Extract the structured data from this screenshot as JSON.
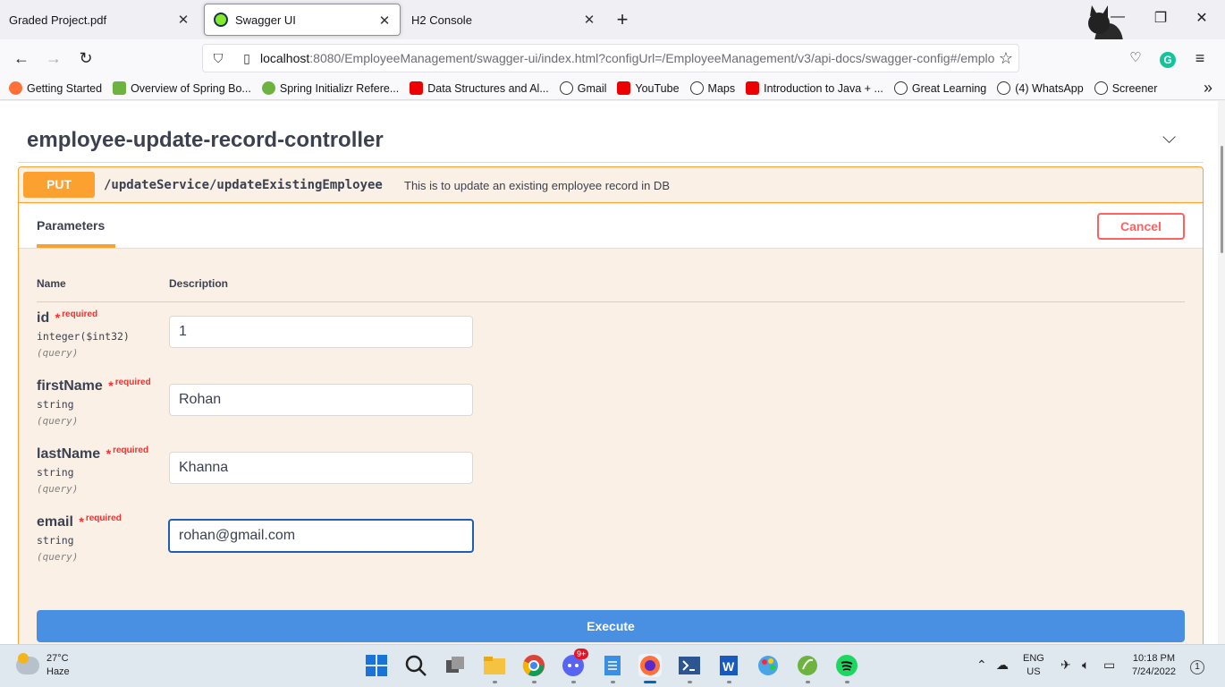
{
  "tabs": [
    {
      "title": "Graded Project.pdf",
      "close": "✕"
    },
    {
      "title": "Swagger UI",
      "close": "✕"
    },
    {
      "title": "H2 Console",
      "close": "✕"
    }
  ],
  "window_controls": {
    "minimize": "—",
    "restore": "❐",
    "close": "✕"
  },
  "url": {
    "host": "localhost",
    "rest": ":8080/EmployeeManagement/swagger-ui/index.html?configUrl=/EmployeeManagement/v3/api-docs/swagger-config#/emplo"
  },
  "bookmarks": [
    {
      "label": "Getting Started",
      "icon": "firefox-icon"
    },
    {
      "label": "Overview of Spring Bo...",
      "icon": "spring-icon"
    },
    {
      "label": "Spring Initializr Refere...",
      "icon": "spring-initializr-icon"
    },
    {
      "label": "Data Structures and Al...",
      "icon": "youtube-icon"
    },
    {
      "label": "Gmail",
      "icon": "globe-icon"
    },
    {
      "label": "YouTube",
      "icon": "youtube-icon"
    },
    {
      "label": "Maps",
      "icon": "globe-icon"
    },
    {
      "label": "Introduction to Java + ...",
      "icon": "youtube-icon"
    },
    {
      "label": "Great Learning",
      "icon": "globe-icon"
    },
    {
      "label": "(4) WhatsApp",
      "icon": "globe-icon"
    },
    {
      "label": "Screener",
      "icon": "globe-icon"
    }
  ],
  "section": {
    "title": "employee-update-record-controller"
  },
  "operation": {
    "method": "PUT",
    "path": "/updateService/updateExistingEmployee",
    "description": "This is to update an existing employee record in DB",
    "tab_label": "Parameters",
    "cancel_label": "Cancel",
    "col_name": "Name",
    "col_description": "Description",
    "required_label": "required",
    "required_star": "*",
    "params": [
      {
        "name": "id",
        "type": "integer($int32)",
        "in": "(query)",
        "value": "1"
      },
      {
        "name": "firstName",
        "type": "string",
        "in": "(query)",
        "value": "Rohan"
      },
      {
        "name": "lastName",
        "type": "string",
        "in": "(query)",
        "value": "Khanna"
      },
      {
        "name": "email",
        "type": "string",
        "in": "(query)",
        "value": "rohan@gmail.com"
      }
    ],
    "execute_label": "Execute"
  },
  "taskbar": {
    "temp": "27°C",
    "weather": "Haze",
    "lang1": "ENG",
    "lang2": "US",
    "time": "10:18 PM",
    "date": "7/24/2022",
    "notifications": "1",
    "discord_badge": "9+"
  },
  "colors": {
    "put": "#fca130",
    "execute": "#4990e2",
    "cancel": "#ff6060"
  }
}
